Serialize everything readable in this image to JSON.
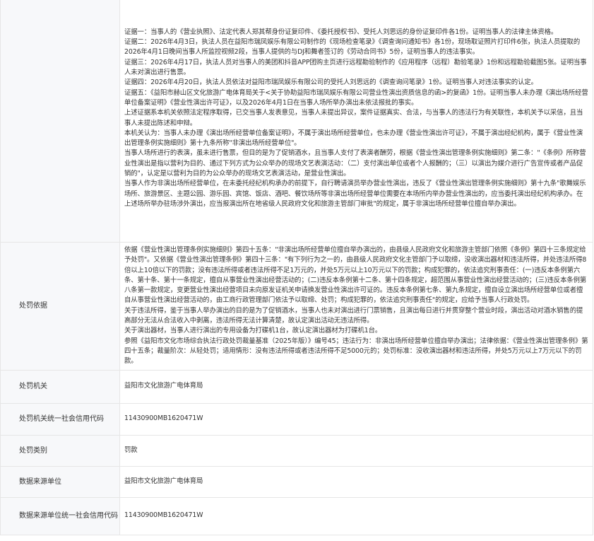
{
  "rows": {
    "evidence": {
      "label": "",
      "paragraphs": [
        "证据一：当事人的《营业执照》、法定代表人郑其帮身份证复印件、《委托授权书》、受托人刘思远的身份证复印件各1份。证明当事人的法律主体资格。",
        "证据二：2026年4月3日，执法人员在益阳市瑞凤娱乐有限公司制作的《现场检查笔录》《调查询问通知书》各1份，现场取证照片打印件6张，执法人员提取的2026年4月1日晚间当事人所监控视频2段，当事人提供的与DJ和舞者签订的《劳动合同书》5份，证明当事人的违法事实。",
        "证据三：2026年4月17日，执法人员对当事人的美团和抖音APP团购主页进行远程勘验制作的《应用程序（远程）勘验笔录》1份和远程勘验截图5张。证明当事人未对演出进行售票。",
        "证据四：2026年4月20日，执法人员依法对益阳市瑞凤娱乐有限公司的受托人刘思远的《调查询问笔录》1份。证明当事人对违法事实的认定。",
        "证据五：《益阳市赫山区文化旅游广电体育局关于<关于协助益阳市瑞凤娱乐有限公司营业性演出资质信息的函>的复函》1份。证明当事人未办理《演出场所经营单位备案证明》《营业性演出许可证》，以及2026年4月1日在当事人场所举办演出未依法报批的事实。",
        "上述证据系本机关依照法定程序取得，已交当事人发表意见，当事人未提出异议，案件证据真实、合法，与当事人的违法行为有关联性，本机关予以采信，且当事人未提出陈述和申辩。",
        "本机关认为：当事人未办理《演出场所经营单位备案证明》，不属于演出场所经营单位，也未办理《营业性演出许可证》，不属于演出经纪机构，属于《营业性演出管理条例实施细则》第十九条所称\"非演出场所经营单位\"。",
        "当事人场所进行的表演，虽未进行售票，但目的是为了促销酒水，且当事人支付了表演者酬劳，根据《营业性演出管理条例实施细则》第二条：\"《条例》所称营业性演出是指以营利为目的、通过下列方式为公众举办的现场文艺表演活动：（二）支付演出单位或者个人报酬的；（三）以演出为媒介进行广告宣传或者产品促销的\"，认定是以营利为目的为公众举办的现场文艺表演活动，是营业性演出。",
        "当事人作为非演出场所经营单位，在未委托经纪机构承办的前提下，自行聘请演员举办营业性演出，违反了《营业性演出管理条例实施细则》第十九条\"歌舞娱乐场所、旅游景区、主题公园、游乐园、宾馆、饭店、酒吧、餐饮场所等非演出场所经营单位需要在本场所内举办营业性演出的，应当委托演出经纪机构承办。在上述场所举办驻场涉外演出，应当报演出所在地省级人民政府文化和旅游主管部门审批\"的规定，属于非演出场所经营单位擅自举办演出。"
      ]
    },
    "basis": {
      "label": "处罚依据",
      "paragraphs": [
        "依据《营业性演出管理条例实施细则》第四十五条：\"非演出场所经营单位擅自举办演出的，由县级人民政府文化和旅游主管部门依照《条例》第四十三条规定给予处罚\"。又依据《营业性演出管理条例》第四十三条：\"有下列行为之一的，由县级人民政府文化主管部门予以取缔，没收演出器材和违法所得，并处违法所得8倍以上10倍以下的罚款；没有违法所得或者违法所得不足1万元的，并处5万元以上10万元以下的罚款；构成犯罪的，依法追究刑事责任：(一)违反本条例第六条、第十条、第十一条规定，擅自从事营业性演出经营活动的；(二)违反本条例第十二条、第十四条规定，超范围从事营业性演出经营活动的；(三)违反本条例第八条第一款规定，变更营业性演出经营项目未向原发证机关申请换发营业性演出许可证的。违反本条例第七条、第九条规定，擅自设立演出场所经营单位或者擅自从事营业性演出经营活动的，由工商行政管理部门依法予以取缔、处罚；构成犯罪的，依法追究刑事责任\"的规定，应给予当事人行政处罚。",
        "关于违法所得，鉴于当事人举办演出的目的是为了促销酒水，当事人也未对演出进行门票销售，且演出每日进行并贯穿整个营业时段，演出活动对酒水销售的提高部分无法从合法收入中剥离，违法所得无法计算清楚，故认定演出活动无违法所得。",
        "关于演出器材，当事人进行演出的专用设备为打碟机1台，故认定演出器材为打碟机1台。",
        "参照《益阳市文化市场综合执法行政处罚裁量基准（2025年版）》编号45；违法行为：非演出场所经营单位擅自举办演出；法律依据：《营业性演出管理条例》第四十五条；裁量阶次：从轻处罚；适用情形：没有违法所得或者违法所得不足5000元的；处罚标准：没收演出器材和违法所得，并处5万元以上7万元以下的罚款。"
      ]
    },
    "org": {
      "label": "处罚机关",
      "value": "益阳市文化旅游广电体育局"
    },
    "org_code": {
      "label": "处罚机关统一社会信用代码",
      "value": "11430900MB1620471W"
    },
    "category": {
      "label": "处罚类别",
      "value": "罚款"
    },
    "source": {
      "label": "数据来源单位",
      "value": "益阳市文化旅游广电体育局"
    },
    "source_code": {
      "label": "数据来源单位统一社会信用代码",
      "value": "11430900MB1620471W"
    }
  }
}
